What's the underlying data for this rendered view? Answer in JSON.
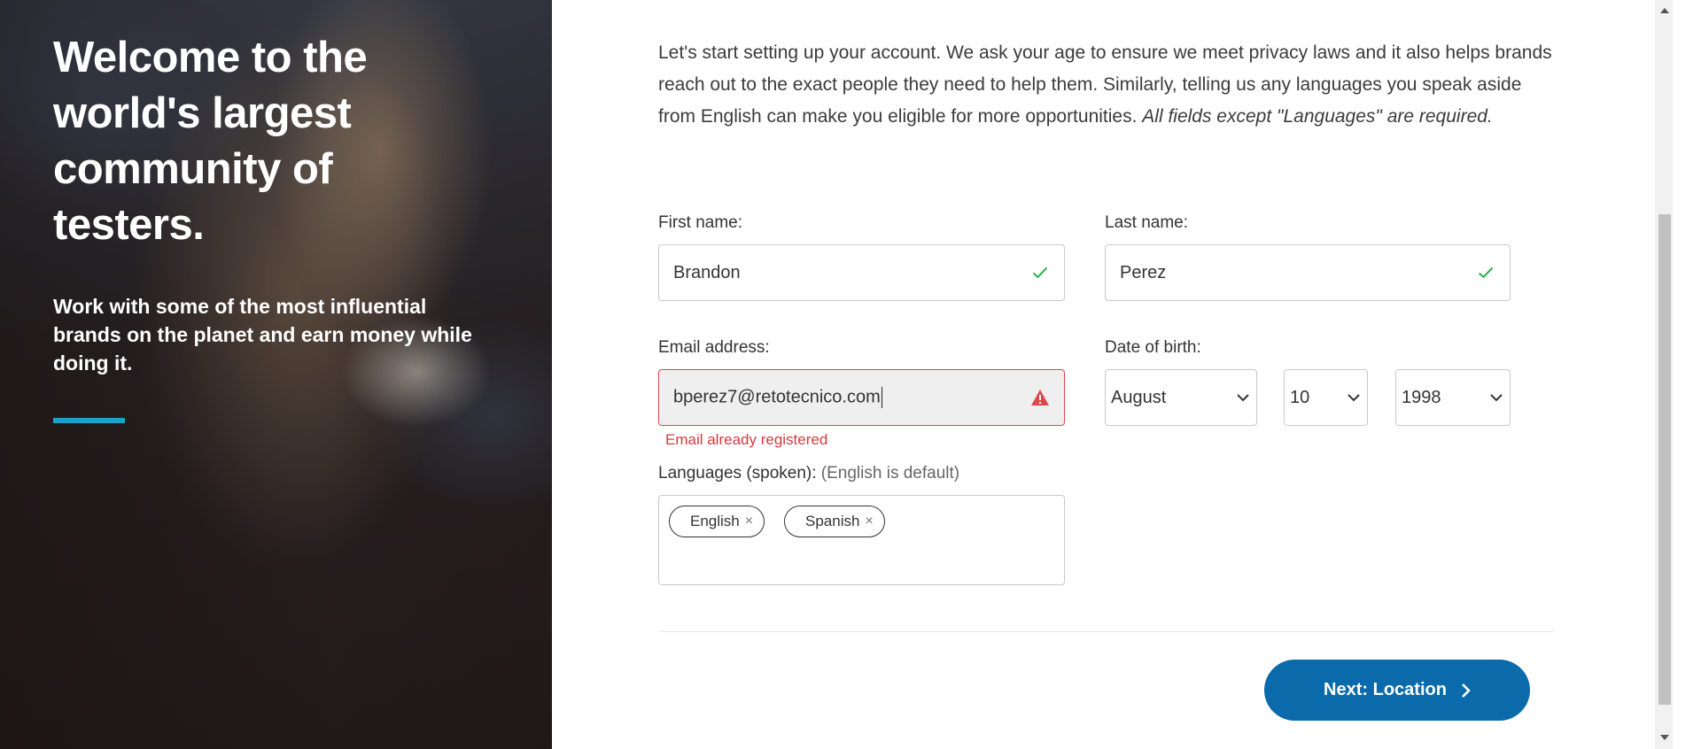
{
  "hero": {
    "title": "Welcome to the world's largest community of testers.",
    "subtitle": "Work with some of the most influential brands on the planet and earn money while doing it.",
    "accent_color": "#1aa3c9"
  },
  "intro": {
    "text": "Let's start setting up your account. We ask your age to ensure we meet privacy laws and it also helps brands reach out to the exact people they need to help them. Similarly, telling us any languages you speak aside from English can make you eligible for more opportunities. ",
    "italic_text": "All fields except \"Languages\" are required."
  },
  "form": {
    "first_name": {
      "label": "First name:",
      "value": "Brandon",
      "status_icon": "check-icon"
    },
    "last_name": {
      "label": "Last name:",
      "value": "Perez",
      "status_icon": "check-icon"
    },
    "email": {
      "label": "Email address:",
      "value": "bperez7@retotecnico.com",
      "status_icon": "warning-icon",
      "error": "Email already registered"
    },
    "dob": {
      "label": "Date of birth:",
      "month": "August",
      "day": "10",
      "year": "1998"
    },
    "languages": {
      "label": "Languages (spoken):",
      "hint": "(English is default)",
      "tags": [
        {
          "label": "English",
          "remove": "×"
        },
        {
          "label": "Spanish",
          "remove": "×"
        }
      ]
    }
  },
  "next_button": {
    "label": "Next: Location",
    "color": "#0a6aaa"
  },
  "colors": {
    "success": "#2bb24c",
    "error": "#e0474c"
  }
}
